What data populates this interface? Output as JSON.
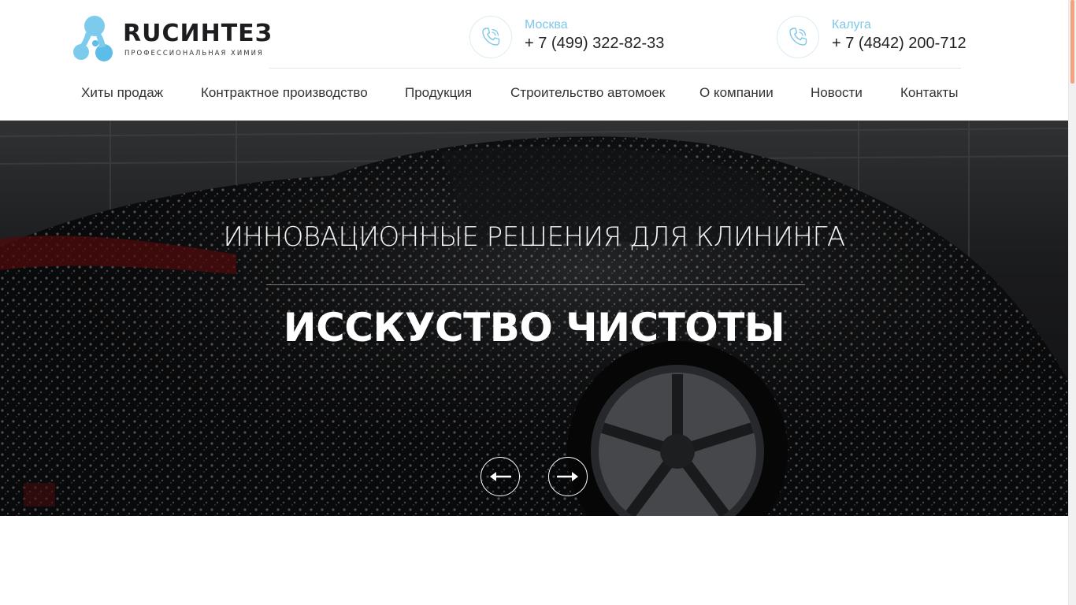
{
  "brand": {
    "name": "RUСИНТЕЗ",
    "tagline": "ПРОФЕССИОНАЛЬНАЯ ХИМИЯ",
    "logo_colors": [
      "#7ccbed",
      "#3fb0e4"
    ]
  },
  "contacts": [
    {
      "city": "Москва",
      "phone": "+ 7 (499) 322-82-33",
      "icon": "phone-icon"
    },
    {
      "city": "Калуга",
      "phone": "+ 7 (4842) 200-712",
      "icon": "phone-icon"
    }
  ],
  "nav": {
    "items": [
      {
        "label": "Хиты продаж"
      },
      {
        "label": "Контрактное производство"
      },
      {
        "label": "Продукция"
      },
      {
        "label": "Строительство автомоек"
      },
      {
        "label": "О компании"
      },
      {
        "label": "Новости"
      },
      {
        "label": "Контакты"
      }
    ]
  },
  "hero": {
    "subtitle": "ИННОВАЦИОННЫЕ РЕШЕНИЯ ДЛЯ КЛИНИНГА",
    "title": "ИССКУСТВО ЧИСТОТЫ",
    "prev_icon": "arrow-left-icon",
    "next_icon": "arrow-right-icon"
  },
  "colors": {
    "accent": "#7fc8e8",
    "text_dark": "#222222",
    "scroll_thumb": "#f3a27f"
  }
}
